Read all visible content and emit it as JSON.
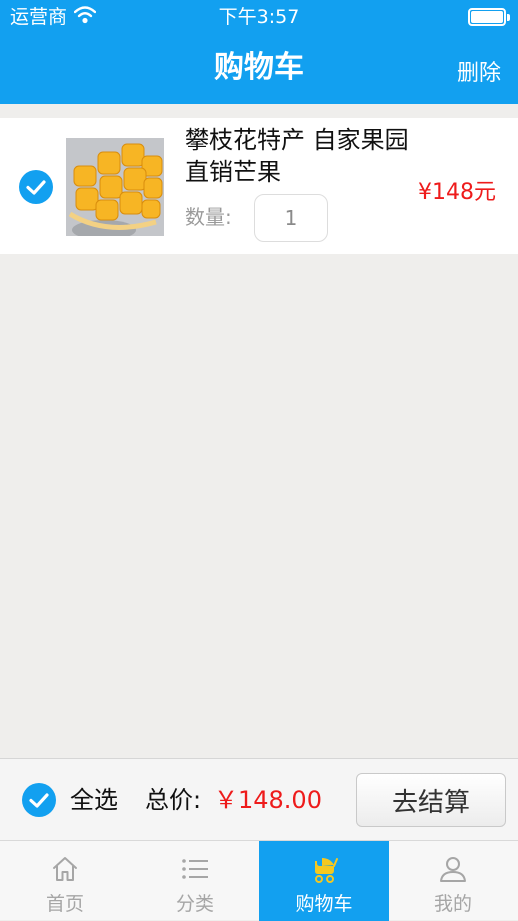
{
  "status_bar": {
    "carrier": "运营商",
    "time": "下午3:57"
  },
  "nav": {
    "title": "购物车",
    "delete_label": "删除"
  },
  "cart": {
    "items": [
      {
        "name": "攀枝花特产 自家果园直销芒果",
        "qty_label": "数量:",
        "quantity": "1",
        "price": "¥148元",
        "checked": true,
        "image_icon": "mango-image"
      }
    ]
  },
  "summary": {
    "select_all_label": "全选",
    "total_label": "总价:",
    "total_value": "￥148.00",
    "checkout_label": "去结算",
    "select_all_checked": true
  },
  "tabs": [
    {
      "label": "首页",
      "icon": "home-icon",
      "active": false
    },
    {
      "label": "分类",
      "icon": "list-icon",
      "active": false
    },
    {
      "label": "购物车",
      "icon": "stroller-icon",
      "active": true
    },
    {
      "label": "我的",
      "icon": "user-icon",
      "active": false
    }
  ],
  "colors": {
    "primary": "#12a0f0",
    "price": "#ee1b1b",
    "background": "#efeeec",
    "cart_icon": "#f4c820"
  }
}
